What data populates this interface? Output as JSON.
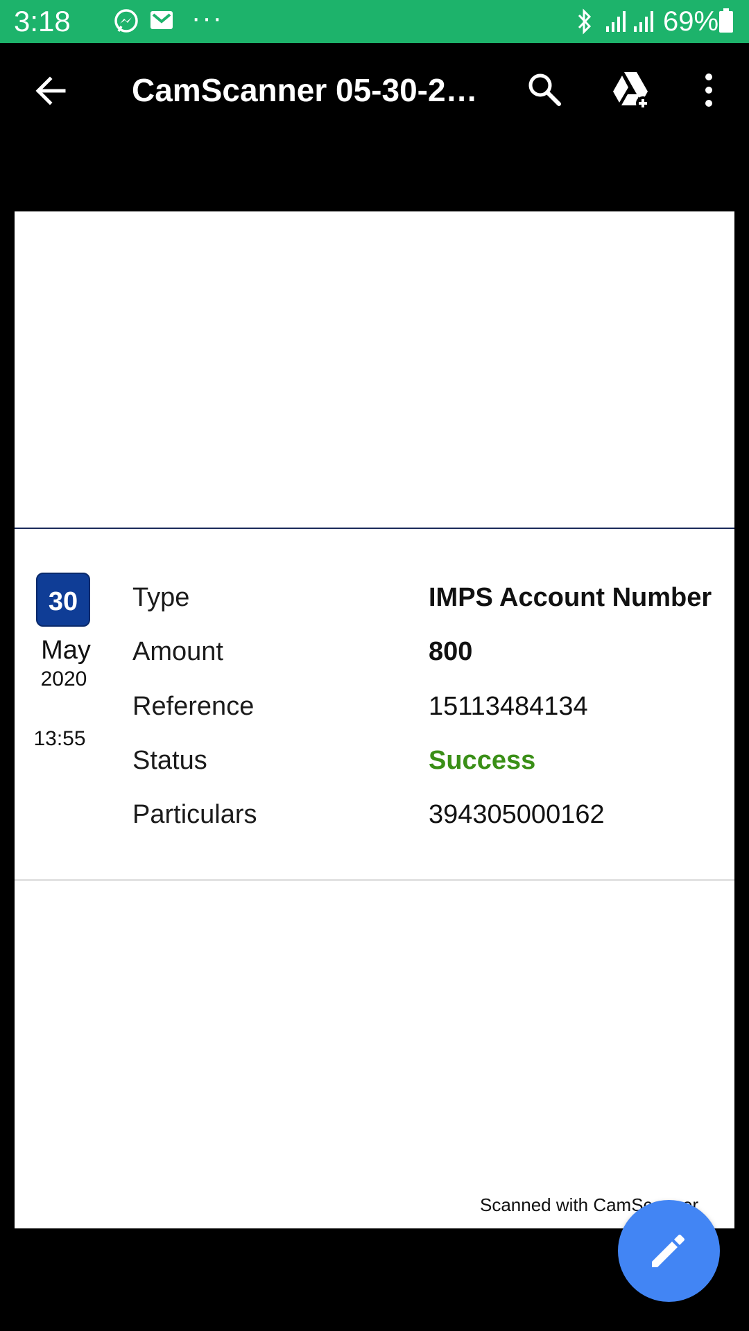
{
  "status_bar": {
    "time": "3:18",
    "battery_percent": "69%",
    "notification_icons": [
      "messenger-icon",
      "gmail-icon",
      "more-notifications-icon"
    ],
    "system_icons": [
      "bluetooth-icon",
      "signal-icon",
      "signal-icon",
      "battery-icon"
    ]
  },
  "app_bar": {
    "title": "CamScanner 05-30-20…",
    "icons": [
      "back-arrow-icon",
      "search-icon",
      "drive-add-icon",
      "overflow-menu-icon"
    ]
  },
  "document": {
    "date": {
      "day": "30",
      "month": "May",
      "year": "2020",
      "time": "13:55"
    },
    "rows": [
      {
        "label": "Type",
        "value": "IMPS Account Number"
      },
      {
        "label": "Amount",
        "value": "800"
      },
      {
        "label": "Reference",
        "value": "15113484134"
      },
      {
        "label": "Status",
        "value": "Success"
      },
      {
        "label": "Particulars",
        "value": "394305000162"
      }
    ],
    "watermark": "Scanned with CamScanner"
  },
  "fab": {
    "icon": "edit-pencil-icon"
  },
  "colors": {
    "status_bar_bg": "#1db36b",
    "app_bar_bg": "#000000",
    "page_bg": "#ffffff",
    "date_badge": "#0f3d96",
    "status_success": "#3a8f17",
    "fab_bg": "#4285f4"
  }
}
